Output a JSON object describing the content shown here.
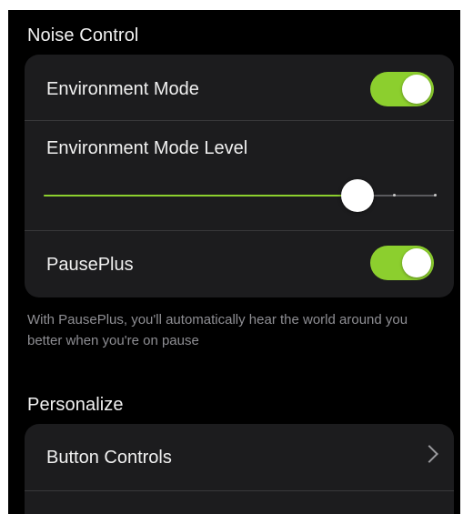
{
  "colors": {
    "accent": "#8ccf2e",
    "background": "#000000",
    "card": "#1c1c1e",
    "text_primary": "#f0f0f0",
    "text_secondary": "#8e8e93"
  },
  "noise_control": {
    "header": "Noise Control",
    "environment_mode": {
      "label": "Environment Mode",
      "enabled": true
    },
    "environment_mode_level": {
      "label": "Environment Mode Level",
      "value_fraction": 0.8
    },
    "pauseplus": {
      "label": "PausePlus",
      "enabled": true
    },
    "footnote": "With PausePlus, you'll automatically hear the world around you better when you're on pause"
  },
  "personalize": {
    "header": "Personalize",
    "button_controls": {
      "label": "Button Controls",
      "icon": "chevron-right-icon"
    }
  }
}
